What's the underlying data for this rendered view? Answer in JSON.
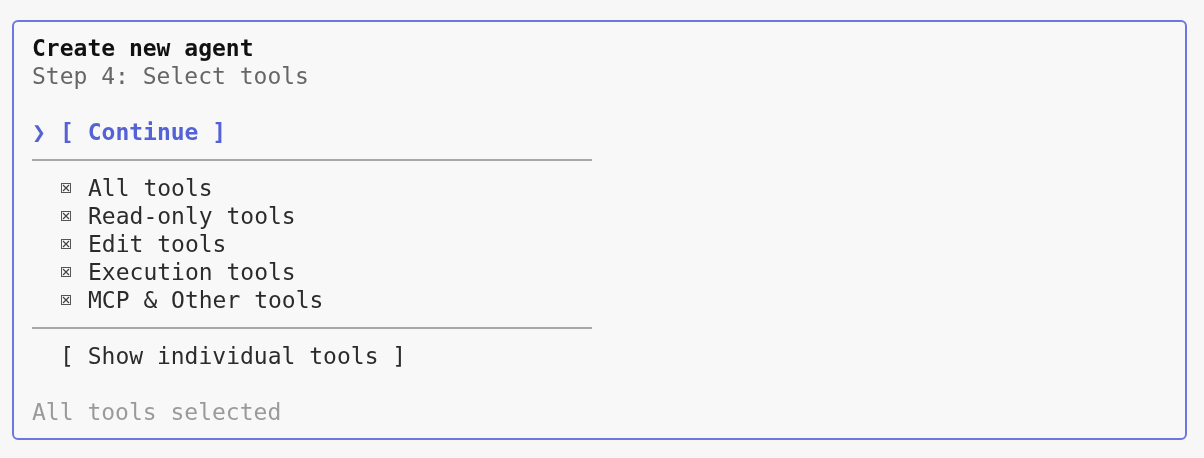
{
  "dialog": {
    "title": "Create new agent",
    "subtitle": "Step 4: Select tools",
    "pointer": "❯",
    "actions": [
      {
        "label": "[ Continue ]",
        "selected": true
      },
      {
        "label": "[ Show individual tools ]",
        "selected": false
      }
    ],
    "options": [
      {
        "label": "All tools",
        "checked": true
      },
      {
        "label": "Read-only tools",
        "checked": true
      },
      {
        "label": "Edit tools",
        "checked": true
      },
      {
        "label": "Execution tools",
        "checked": true
      },
      {
        "label": "MCP & Other tools",
        "checked": true
      }
    ],
    "status": "All tools selected"
  }
}
